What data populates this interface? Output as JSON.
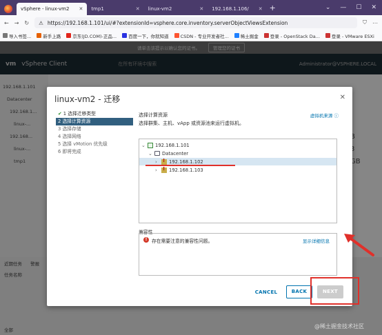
{
  "browser": {
    "tabs": [
      {
        "label": "vSphere - linux-vm2",
        "active": true
      },
      {
        "label": "tmp1",
        "active": false
      },
      {
        "label": "linux-vm2",
        "active": false
      },
      {
        "label": "192.168.1.106/",
        "active": false
      }
    ],
    "url": "https://192.168.1.101/ui/#?extensionId=vsphere.core.inventory.serverObjectViewsExtension",
    "bookmarks": [
      "导入书签...",
      "新手上路",
      "京东(JD.COM)-正品...",
      "百度一下，你就知道",
      "CSDN - 专业开发者社...",
      "稀土掘金",
      "登录 - OpenStack Da...",
      "登录 - VMware ESXi"
    ]
  },
  "background": {
    "banner_text": "请单击该提示以确认您的证书。",
    "banner_button": "管理您的证书",
    "product": "vSphere Client",
    "search_placeholder": "在所有环境中搜索",
    "user": "Administrator@VSPHERE.LOCAL",
    "tree": [
      "192.168.1.101",
      "Datacenter",
      "192.168.1...",
      "linux-...",
      "192.168...",
      "linux-...",
      "tmp1"
    ],
    "right_values": [
      "B",
      "3",
      "GB"
    ],
    "recent_tasks_tab": "近期任务",
    "alarms_tab": "警报",
    "task_name_col": "任务名称",
    "filter_label": "全部"
  },
  "dialog": {
    "title": "linux-vm2 - 迁移",
    "steps": [
      {
        "label": "1 选择迁移类型",
        "state": "done"
      },
      {
        "label": "2 选择计算资源",
        "state": "active"
      },
      {
        "label": "3 选择存储",
        "state": "pending"
      },
      {
        "label": "4 选择网络",
        "state": "pending"
      },
      {
        "label": "5 选择 vMotion 优先级",
        "state": "pending"
      },
      {
        "label": "6 即将完成",
        "state": "pending"
      }
    ],
    "content_title": "选择计算资源",
    "content_desc": "选择群集、主机、vApp 或资源池来运行虚拟机。",
    "vm_source_link": "虚拟机来源",
    "tree": [
      {
        "label": "192.168.1.101",
        "level": 0,
        "expanded": true
      },
      {
        "label": "Datacenter",
        "level": 1,
        "expanded": true
      },
      {
        "label": "192.168.1.102",
        "level": 2,
        "expanded": false,
        "selected": true
      },
      {
        "label": "192.168.1.103",
        "level": 2,
        "expanded": false,
        "selected": false
      }
    ],
    "compat_label": "兼容性",
    "compat_error": "存在需要注意的兼容性问题。",
    "compat_details_link": "显示详细信息",
    "buttons": {
      "cancel": "CANCEL",
      "back": "BACK",
      "next": "NEXT"
    }
  },
  "watermark": "@稀土掘金技术社区",
  "colors": {
    "accent": "#0073ae",
    "active_step": "#315f7f",
    "error": "#d43a2a",
    "annotation": "#e0302a"
  }
}
